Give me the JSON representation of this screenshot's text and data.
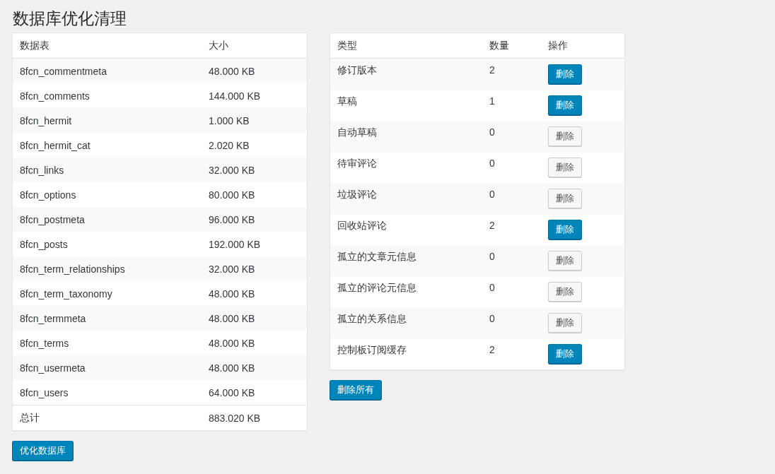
{
  "title": "数据库优化清理",
  "tables": {
    "columns": [
      "数据表",
      "大小"
    ],
    "rows": [
      {
        "name": "8fcn_commentmeta",
        "size": "48.000 KB"
      },
      {
        "name": "8fcn_comments",
        "size": "144.000 KB"
      },
      {
        "name": "8fcn_hermit",
        "size": "1.000 KB"
      },
      {
        "name": "8fcn_hermit_cat",
        "size": "2.020 KB"
      },
      {
        "name": "8fcn_links",
        "size": "32.000 KB"
      },
      {
        "name": "8fcn_options",
        "size": "80.000 KB"
      },
      {
        "name": "8fcn_postmeta",
        "size": "96.000 KB"
      },
      {
        "name": "8fcn_posts",
        "size": "192.000 KB"
      },
      {
        "name": "8fcn_term_relationships",
        "size": "32.000 KB"
      },
      {
        "name": "8fcn_term_taxonomy",
        "size": "48.000 KB"
      },
      {
        "name": "8fcn_termmeta",
        "size": "48.000 KB"
      },
      {
        "name": "8fcn_terms",
        "size": "48.000 KB"
      },
      {
        "name": "8fcn_usermeta",
        "size": "48.000 KB"
      },
      {
        "name": "8fcn_users",
        "size": "64.000 KB"
      }
    ],
    "total": {
      "label": "总计",
      "size": "883.020 KB"
    }
  },
  "optimize_button": "优化数据库",
  "cleanup": {
    "columns": [
      "类型",
      "数量",
      "操作"
    ],
    "rows": [
      {
        "type": "修订版本",
        "count": "2",
        "action": "删除",
        "primary": true
      },
      {
        "type": "草稿",
        "count": "1",
        "action": "删除",
        "primary": true
      },
      {
        "type": "自动草稿",
        "count": "0",
        "action": "删除",
        "primary": false
      },
      {
        "type": "待审评论",
        "count": "0",
        "action": "删除",
        "primary": false
      },
      {
        "type": "垃圾评论",
        "count": "0",
        "action": "删除",
        "primary": false
      },
      {
        "type": "回收站评论",
        "count": "2",
        "action": "删除",
        "primary": true
      },
      {
        "type": "孤立的文章元信息",
        "count": "0",
        "action": "删除",
        "primary": false
      },
      {
        "type": "孤立的评论元信息",
        "count": "0",
        "action": "删除",
        "primary": false
      },
      {
        "type": "孤立的关系信息",
        "count": "0",
        "action": "删除",
        "primary": false
      },
      {
        "type": "控制板订阅缓存",
        "count": "2",
        "action": "删除",
        "primary": true
      }
    ]
  },
  "delete_all_button": "删除所有"
}
